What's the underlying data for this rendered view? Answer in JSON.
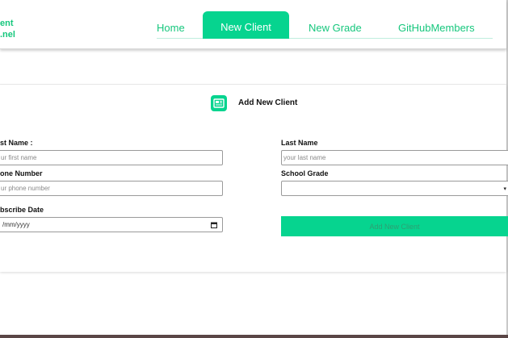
{
  "brand": {
    "text": "ent\n.nel"
  },
  "nav": {
    "home": "Home",
    "new_client": "New Client",
    "new_grade": "New Grade",
    "github_members": "GitHubMembers"
  },
  "form": {
    "title": "Add New Client",
    "icon": "newspaper-icon",
    "first_name": {
      "label": "st Name :",
      "placeholder": "ur first name"
    },
    "last_name": {
      "label": "Last Name",
      "placeholder": "your last name"
    },
    "phone": {
      "label": "one Number",
      "placeholder": "ur phone number"
    },
    "school_grade": {
      "label": "School Grade",
      "value": ""
    },
    "subscribe_date": {
      "label": "bscribe Date",
      "value": "/mm/yyyy"
    },
    "submit_label": "Add New Client"
  },
  "colors": {
    "accent": "#06d48f",
    "accent_text": "#16c77d"
  }
}
